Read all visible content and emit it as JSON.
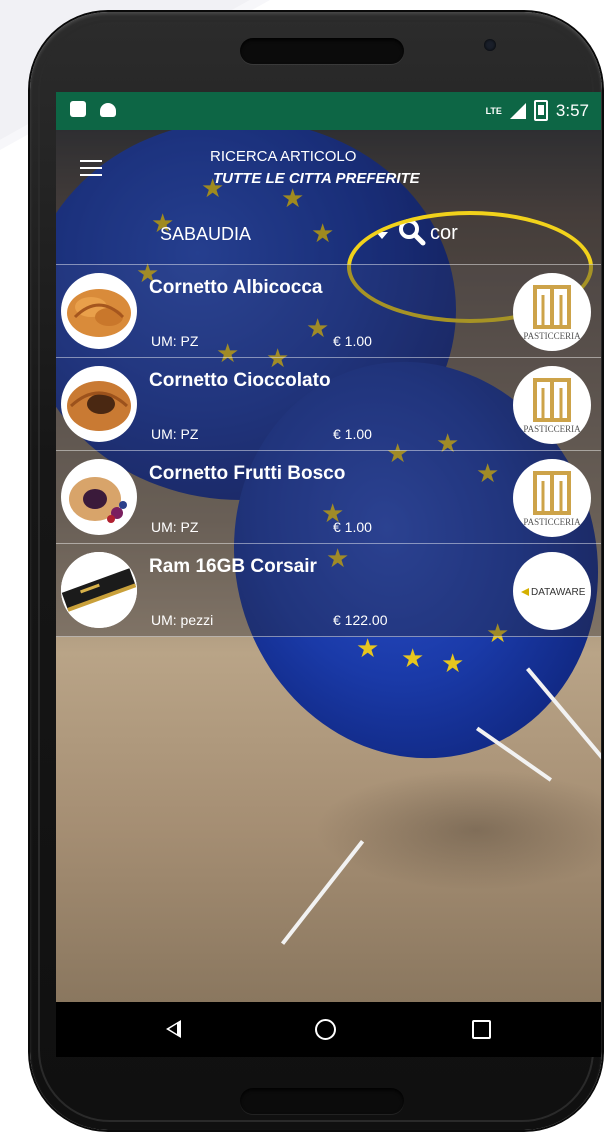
{
  "status_bar": {
    "network": "LTE",
    "time": "3:57",
    "icons": [
      "notification-icon",
      "android-icon",
      "signal-icon",
      "battery-icon"
    ]
  },
  "header": {
    "menu_icon": "hamburger-menu-icon",
    "title": "RICERCA ARTICOLO",
    "subtitle": "TUTTE LE CITTA PREFERITE",
    "city": "SABAUDIA",
    "search_icon": "search-icon",
    "search_value": "cor"
  },
  "items": [
    {
      "name": "Cornetto Albicocca",
      "um": "UM: PZ",
      "price": "€ 1.00",
      "thumb": "croissant-apricot-image",
      "brand": "pasticceria-logo"
    },
    {
      "name": "Cornetto Cioccolato",
      "um": "UM: PZ",
      "price": "€ 1.00",
      "thumb": "croissant-chocolate-image",
      "brand": "pasticceria-logo"
    },
    {
      "name": "Cornetto Frutti Bosco",
      "um": "UM: PZ",
      "price": "€ 1.00",
      "thumb": "croissant-berries-image",
      "brand": "pasticceria-logo"
    },
    {
      "name": "Ram 16GB Corsair",
      "um": "UM: pezzi",
      "price": "€ 122.00",
      "thumb": "ram-module-image",
      "brand": "dataware-logo"
    }
  ],
  "brands": {
    "pasticceria": "PASTICCERIA",
    "dataware": "DATAWARE"
  },
  "nav_bar": {
    "icons": [
      "back-icon",
      "home-icon",
      "recent-apps-icon"
    ]
  },
  "colors": {
    "status_bar": "#0d6645",
    "highlight": "#f1d21b",
    "balloon_blue": "#1a3aa8",
    "star_yellow": "#e7c61e"
  }
}
